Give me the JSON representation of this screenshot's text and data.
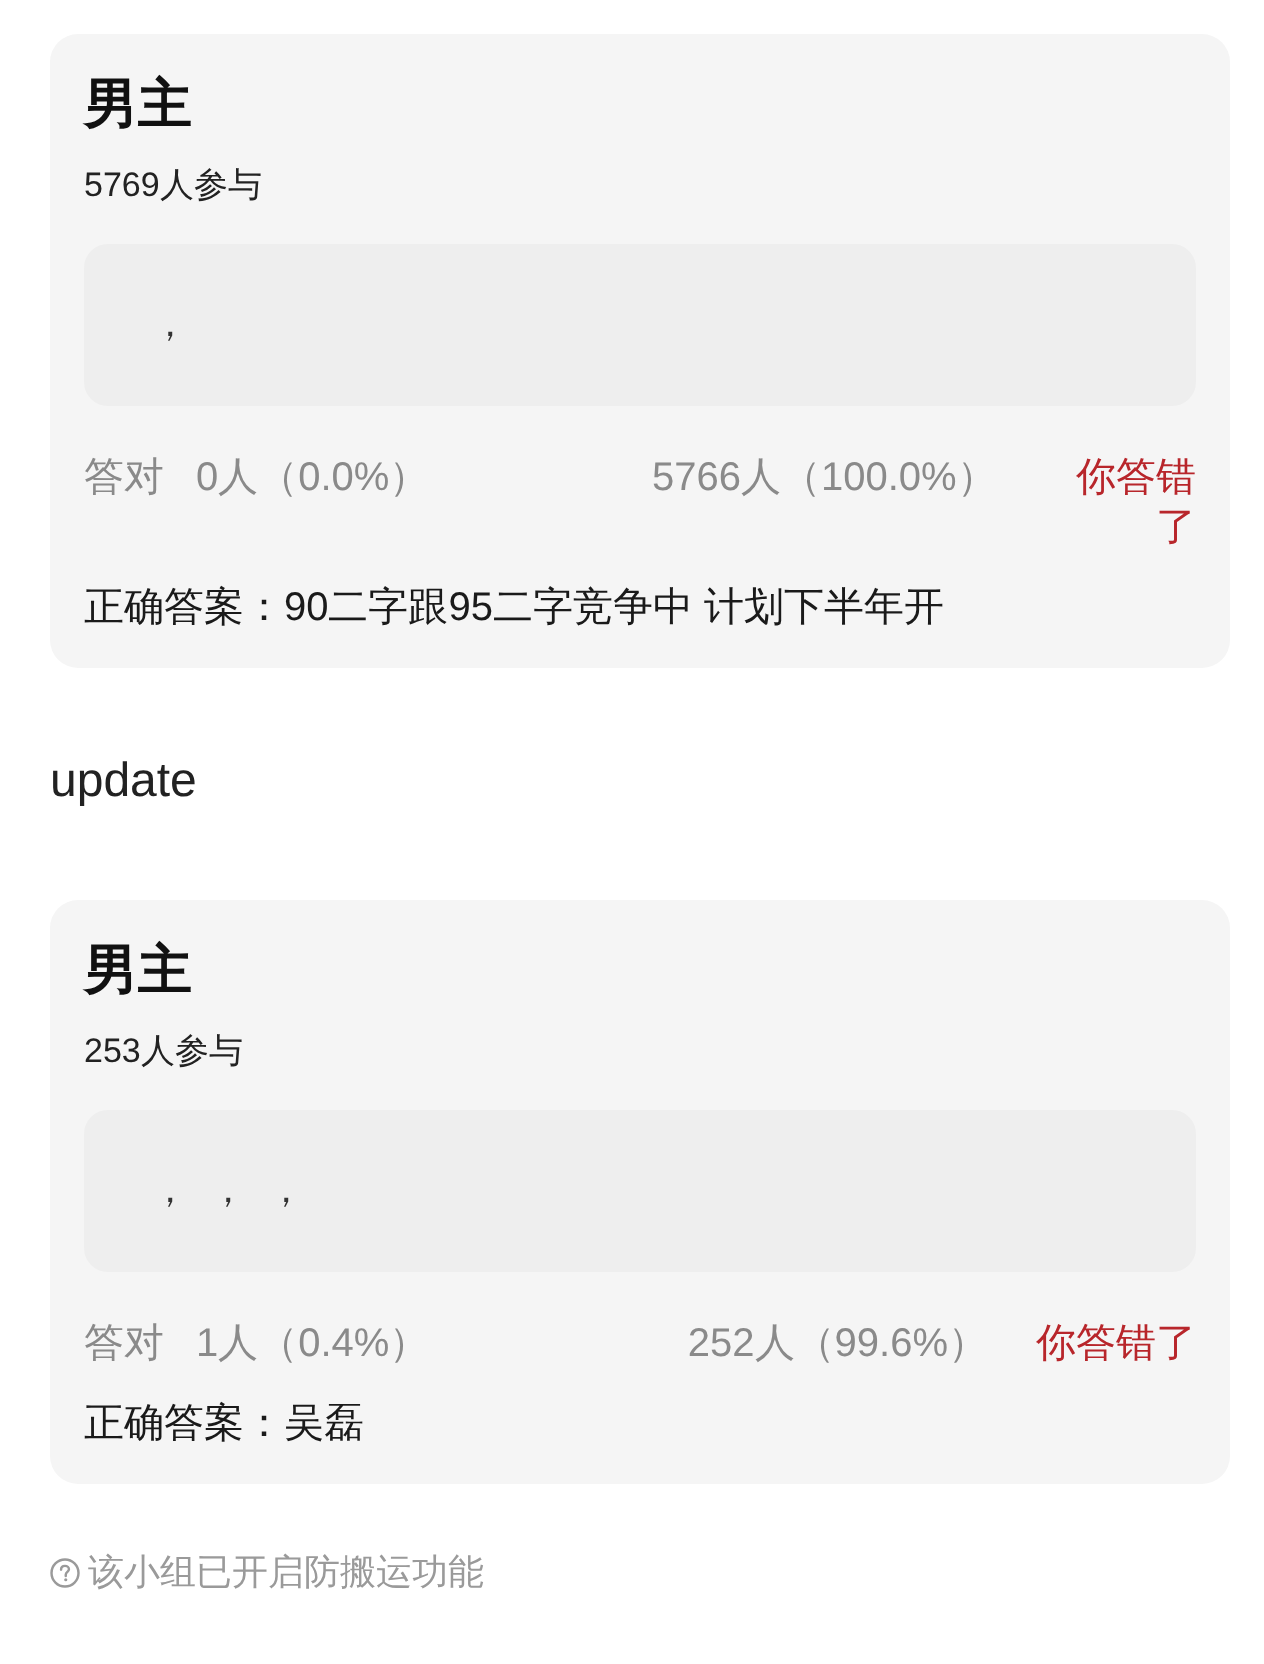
{
  "sections": [
    {
      "kind": "poll",
      "title": "男主",
      "participants": "5769人参与",
      "your_answer": "，",
      "correct_label": "答对",
      "correct_count": "0人（0.0%）",
      "wrong_count": "5766人（100.0%）",
      "result": "你答错了",
      "answered_correctly": false,
      "correct_answer": "正确答案：90二字跟95二字竞争中 计划下半年开"
    },
    {
      "kind": "note",
      "text": "update"
    },
    {
      "kind": "poll",
      "title": "男主",
      "participants": "253人参与",
      "your_answer": "， ， ，",
      "correct_label": "答对",
      "correct_count": "1人（0.4%）",
      "wrong_count": "252人（99.6%）",
      "result": "你答错了",
      "answered_correctly": false,
      "correct_answer": "正确答案：吴磊"
    }
  ],
  "footer": {
    "text": "该小组已开启防搬运功能"
  }
}
